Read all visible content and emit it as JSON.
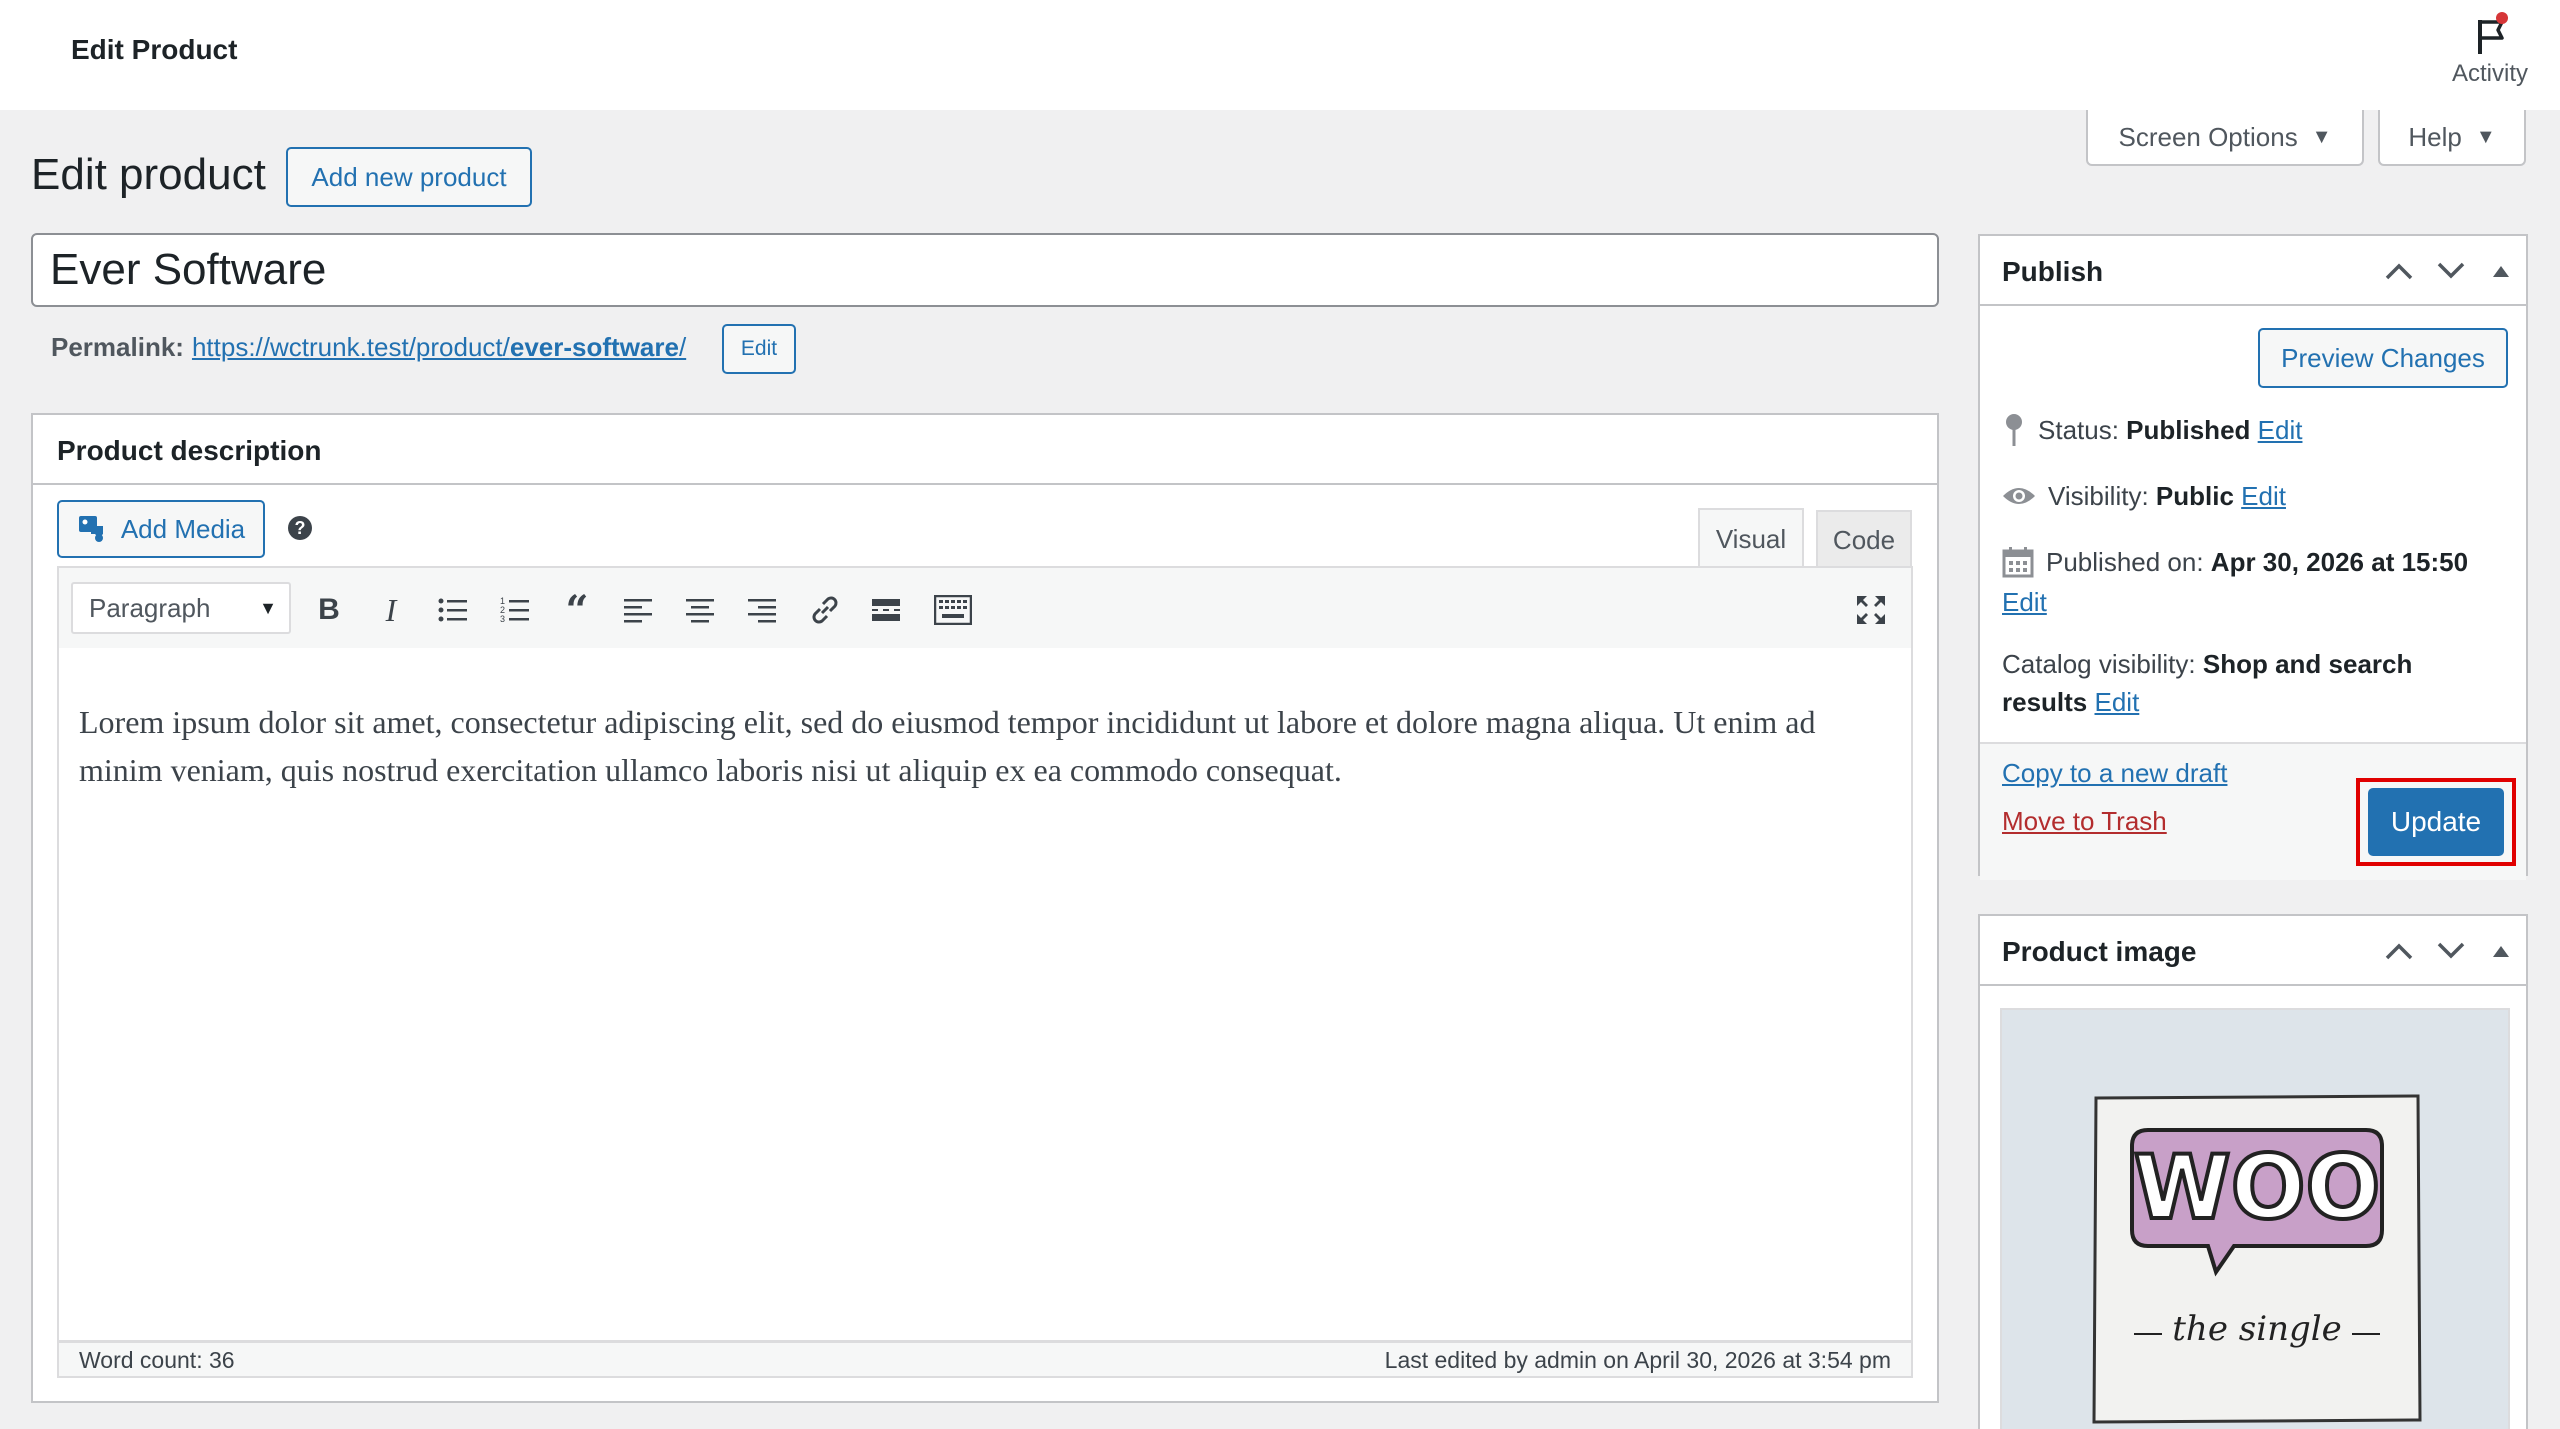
{
  "topbar": {
    "title": "Edit Product",
    "activity_label": "Activity"
  },
  "screen_tabs": {
    "screen_options": "Screen Options",
    "help": "Help"
  },
  "page": {
    "heading": "Edit product",
    "add_new": "Add new product",
    "product_title": "Ever Software"
  },
  "permalink": {
    "label": "Permalink:",
    "url_prefix": "https://wctrunk.test/product/",
    "url_slug": "ever-software",
    "url_suffix": "/",
    "edit": "Edit"
  },
  "description": {
    "title": "Product description",
    "add_media": "Add Media",
    "tab_visual": "Visual",
    "tab_code": "Code",
    "format": "Paragraph",
    "content": "Lorem ipsum dolor sit amet, consectetur adipiscing elit, sed do eiusmod tempor incididunt ut labore et dolore magna aliqua. Ut enim ad minim veniam, quis nostrud exercitation ullamco laboris nisi ut aliquip ex ea commodo consequat.",
    "word_count": "Word count: 36",
    "last_edited": "Last edited by admin on April 30, 2026 at 3:54 pm"
  },
  "publish": {
    "title": "Publish",
    "preview": "Preview Changes",
    "status_label": "Status:",
    "status_value": "Published",
    "visibility_label": "Visibility:",
    "visibility_value": "Public",
    "published_label": "Published on:",
    "published_value": "Apr 30, 2026 at 15:50",
    "catalog_label": "Catalog visibility:",
    "catalog_value_1": "Shop and search",
    "catalog_value_2": "results",
    "edit": "Edit",
    "copy_draft": "Copy to a new draft",
    "trash": "Move to Trash",
    "update": "Update"
  },
  "product_image": {
    "title": "Product image",
    "logo_text": "WOO",
    "caption": "the single"
  },
  "colors": {
    "accent": "#2271b1",
    "trash": "#b32d2e",
    "highlight": "#e00000",
    "logo_purple": "#c8a0c8"
  }
}
